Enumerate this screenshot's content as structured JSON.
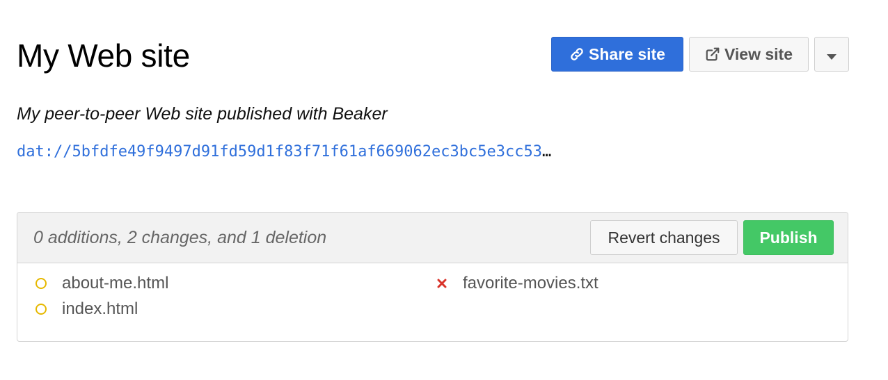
{
  "site": {
    "title": "My Web site",
    "description": "My peer-to-peer Web site published with Beaker",
    "url": "dat://5bfdfe49f9497d91fd59d1f83f71f61af669062ec3bc5e3cc53",
    "url_ellipsis": "…"
  },
  "actions": {
    "share_label": "Share site",
    "share_icon": "link-icon",
    "view_label": "View site",
    "view_icon": "external-link-icon",
    "menu_icon": "caret-down-icon"
  },
  "changes": {
    "summary": "0 additions, 2 changes, and 1 deletion",
    "revert_label": "Revert changes",
    "publish_label": "Publish",
    "files": [
      {
        "name": "about-me.html",
        "status": "modified",
        "icon": "circle-icon"
      },
      {
        "name": "index.html",
        "status": "modified",
        "icon": "circle-icon"
      },
      {
        "name": "favorite-movies.txt",
        "status": "deleted",
        "icon": "x-icon"
      }
    ]
  },
  "colors": {
    "primary": "#2f6fdb",
    "publish": "#44c866",
    "modified": "#e6b800",
    "deleted": "#d9342b"
  }
}
